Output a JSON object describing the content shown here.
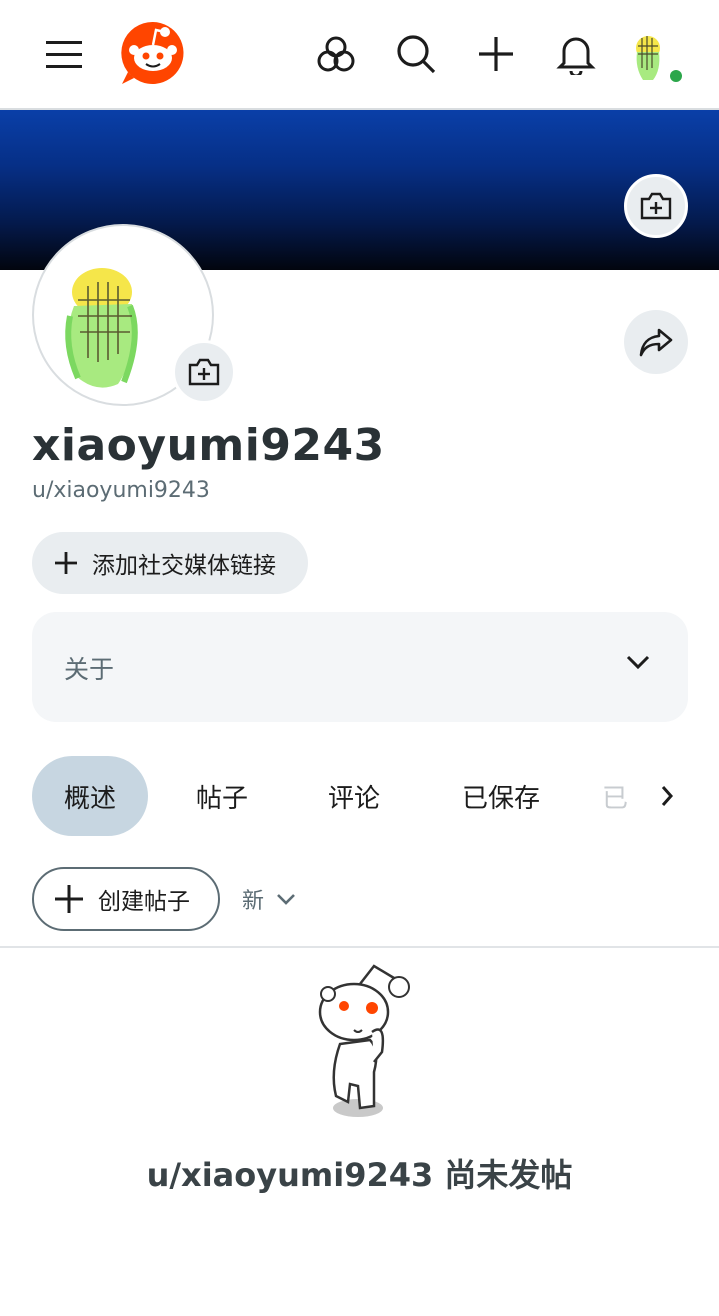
{
  "nav": {
    "menu_icon": "hamburger-menu-icon",
    "logo_icon": "reddit-logo-icon",
    "communities_icon": "communities-icon",
    "search_icon": "search-icon",
    "create_icon": "plus-icon",
    "notifications_icon": "bell-icon",
    "online_status_color": "#2ba64a"
  },
  "profile": {
    "username": "xiaoyumi9243",
    "handle": "u/xiaoyumi9243",
    "banner_color": "#0a3fa8"
  },
  "actions": {
    "add_social_link_label": "添加社交媒体链接",
    "about_label": "关于"
  },
  "tabs": [
    {
      "label": "概述",
      "active": true
    },
    {
      "label": "帖子",
      "active": false
    },
    {
      "label": "评论",
      "active": false
    },
    {
      "label": "已保存",
      "active": false
    },
    {
      "label": "已",
      "active": false
    }
  ],
  "feed": {
    "create_post_label": "创建帖子",
    "sort_label": "新",
    "empty_message": "u/xiaoyumi9243 尚未发帖"
  },
  "colors": {
    "accent": "#ff4500",
    "active_tab": "#c7d6e1",
    "button_bg": "#e9edf0"
  }
}
